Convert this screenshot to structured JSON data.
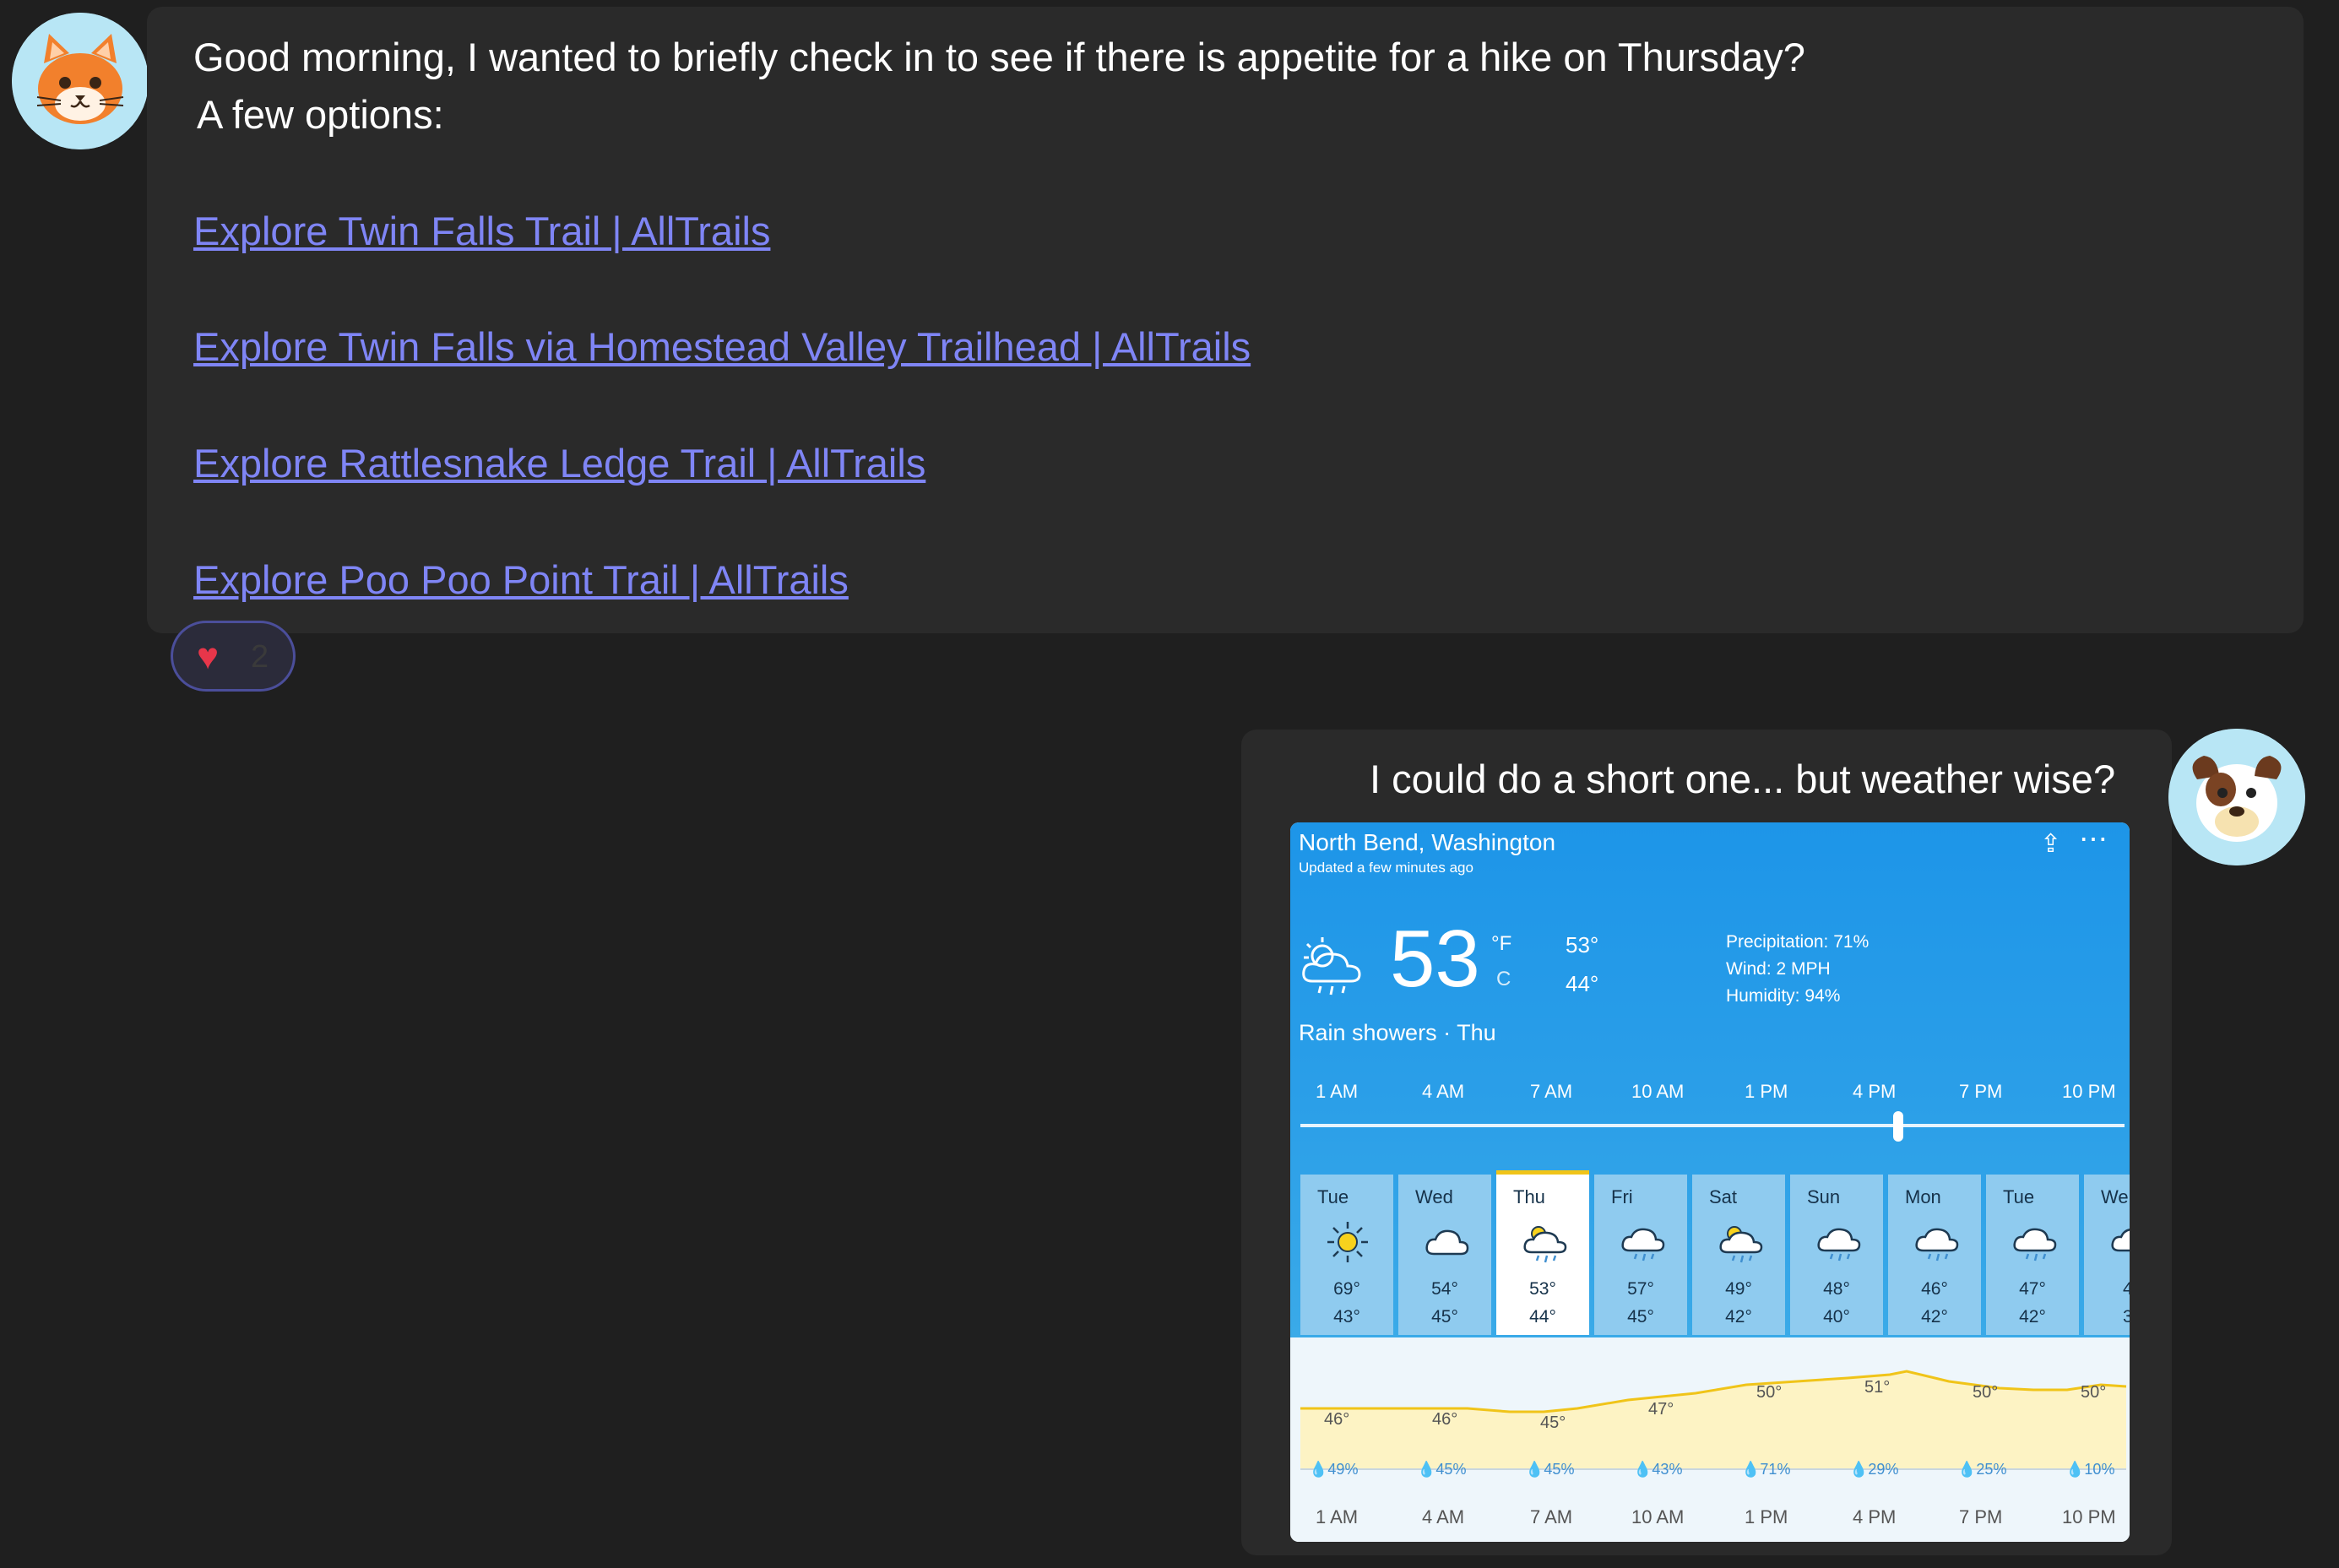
{
  "message1": {
    "line1": "Good morning, I wanted to briefly check in to see if there is appetite for a hike on Thursday?",
    "line2": "A few options:",
    "links": [
      "Explore Twin Falls Trail | AllTrails",
      "Explore Twin Falls via Homestead Valley Trailhead | AllTrails",
      "Explore Rattlesnake Ledge Trail | AllTrails",
      "Explore Poo Poo Point Trail | AllTrails"
    ],
    "reaction": {
      "icon": "heart-icon",
      "count": "2",
      "color": "#e8364a"
    }
  },
  "message2": {
    "text": "I could do a short one... but weather wise?"
  },
  "weather": {
    "location": "North Bend, Washington",
    "updated": "Updated a few minutes ago",
    "temp": "53",
    "unit_f": "°F",
    "unit_c": "C",
    "high": "53°",
    "low": "44°",
    "precipitation": "Precipitation: 71%",
    "wind": "Wind: 2 MPH",
    "humidity": "Humidity: 94%",
    "condition": "Rain showers · Thu",
    "timeline": [
      "1 AM",
      "4 AM",
      "7 AM",
      "10 AM",
      "1 PM",
      "4 PM",
      "7 PM",
      "10 PM"
    ],
    "days": [
      {
        "name": "Tue",
        "hi": "69°",
        "lo": "43°",
        "icon": "sun-icon"
      },
      {
        "name": "Wed",
        "hi": "54°",
        "lo": "45°",
        "icon": "cloud-icon"
      },
      {
        "name": "Thu",
        "hi": "53°",
        "lo": "44°",
        "icon": "partly-cloudy-rain-icon"
      },
      {
        "name": "Fri",
        "hi": "57°",
        "lo": "45°",
        "icon": "rain-icon"
      },
      {
        "name": "Sat",
        "hi": "49°",
        "lo": "42°",
        "icon": "partly-cloudy-rain-icon"
      },
      {
        "name": "Sun",
        "hi": "48°",
        "lo": "40°",
        "icon": "rain-icon"
      },
      {
        "name": "Mon",
        "hi": "46°",
        "lo": "42°",
        "icon": "rain-icon"
      },
      {
        "name": "Tue",
        "hi": "47°",
        "lo": "42°",
        "icon": "rain-icon"
      },
      {
        "name": "We",
        "hi": "4",
        "lo": "3",
        "icon": "rain-icon"
      }
    ],
    "hourly": {
      "temps": [
        "46°",
        "46°",
        "45°",
        "47°",
        "50°",
        "51°",
        "50°",
        "50°"
      ],
      "precip": [
        "49%",
        "45%",
        "45%",
        "43%",
        "71%",
        "29%",
        "25%",
        "10%"
      ],
      "times": [
        "1 AM",
        "4 AM",
        "7 AM",
        "10 AM",
        "1 PM",
        "4 PM",
        "7 PM",
        "10 PM"
      ]
    },
    "colors": {
      "sky": "#1d95e8",
      "selected_accent": "#f0c419",
      "graph_line": "#f0c419"
    }
  }
}
